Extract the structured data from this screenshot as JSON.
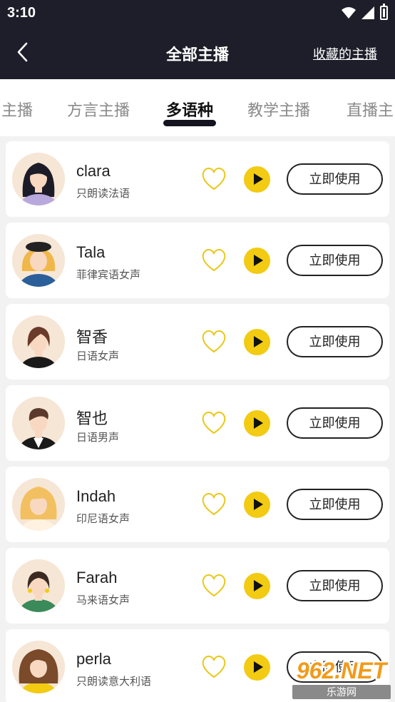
{
  "status": {
    "time": "3:10"
  },
  "header": {
    "title": "全部主播",
    "favorites_link": "收藏的主播"
  },
  "tabs": [
    {
      "label": "主播"
    },
    {
      "label": "方言主播"
    },
    {
      "label": "多语种",
      "active": true
    },
    {
      "label": "教学主播"
    },
    {
      "label": "直播主"
    }
  ],
  "voices": [
    {
      "name": "clara",
      "desc": "只朗读法语",
      "use": "立即使用",
      "avatar": "woman-dark-hair-avatar"
    },
    {
      "name": "Tala",
      "desc": "菲律宾语女声",
      "use": "立即使用",
      "avatar": "woman-beret-avatar"
    },
    {
      "name": "智香",
      "desc": "日语女声",
      "use": "立即使用",
      "avatar": "woman-short-hair-avatar"
    },
    {
      "name": "智也",
      "desc": "日语男声",
      "use": "立即使用",
      "avatar": "man-suit-avatar"
    },
    {
      "name": "Indah",
      "desc": "印尼语女声",
      "use": "立即使用",
      "avatar": "woman-curly-blonde-avatar"
    },
    {
      "name": "Farah",
      "desc": "马来语女声",
      "use": "立即使用",
      "avatar": "woman-bob-avatar"
    },
    {
      "name": "perla",
      "desc": "只朗读意大利语",
      "use": "立即使用",
      "avatar": "woman-curly-brown-avatar"
    }
  ],
  "watermark": {
    "main": "962.NET",
    "sub": "乐游网"
  },
  "colors": {
    "header_bg": "#1e1e2a",
    "accent": "#f2cb12"
  }
}
